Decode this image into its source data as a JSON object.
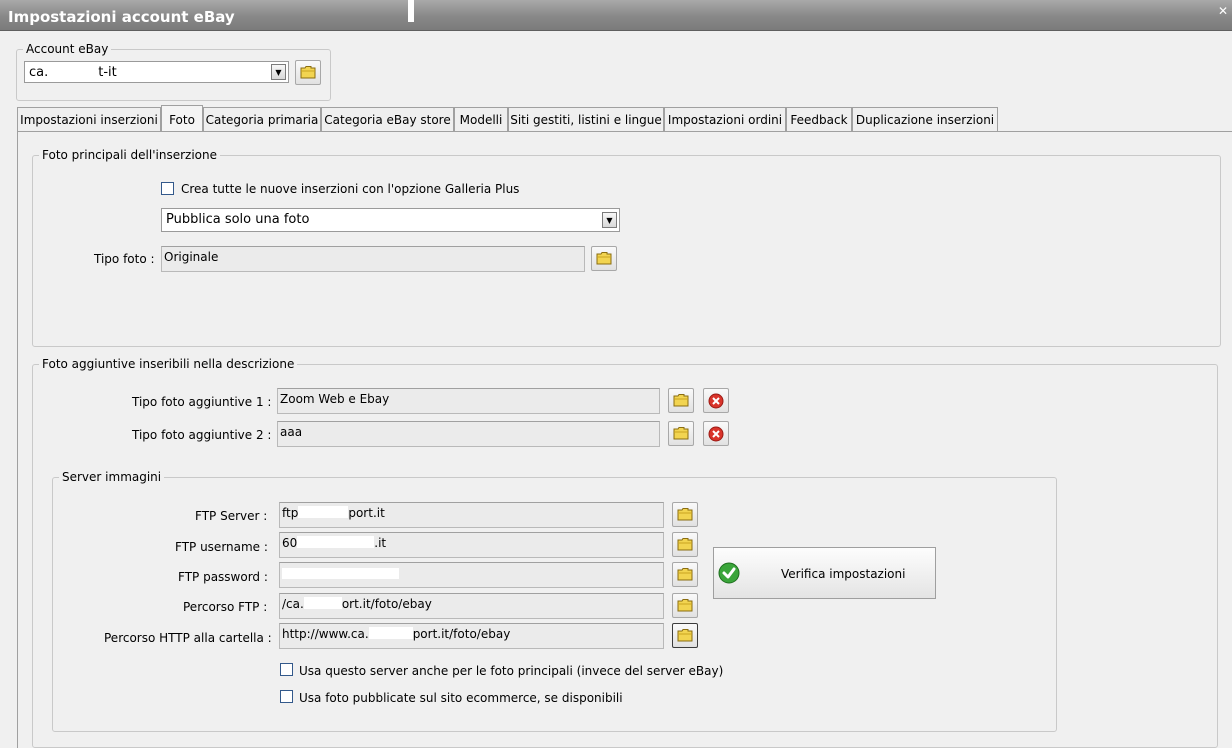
{
  "window": {
    "title": "Impostazioni account eBay"
  },
  "account": {
    "legend": "Account eBay",
    "selected_prefix": "ca.",
    "selected_suffix": "t-it"
  },
  "tabs": [
    {
      "label": "Impostazioni inserzioni",
      "selected": false
    },
    {
      "label": "Foto",
      "selected": true
    },
    {
      "label": "Categoria primaria",
      "selected": false
    },
    {
      "label": "Categoria eBay store",
      "selected": false
    },
    {
      "label": "Modelli",
      "selected": false
    },
    {
      "label": "Siti gestiti, listini e lingue",
      "selected": false
    },
    {
      "label": "Impostazioni ordini",
      "selected": false
    },
    {
      "label": "Feedback",
      "selected": false
    },
    {
      "label": "Duplicazione inserzioni",
      "selected": false
    }
  ],
  "main_photos": {
    "legend": "Foto principali dell'inserzione",
    "gallery_plus_label": "Crea tutte le nuove inserzioni con l'opzione Galleria Plus",
    "gallery_plus_checked": false,
    "publish_option": "Pubblica solo una foto",
    "photo_type_label": "Tipo foto :",
    "photo_type_value": "Originale"
  },
  "additional_photos": {
    "legend": "Foto aggiuntive inseribili nella descrizione",
    "type1_label": "Tipo foto aggiuntive 1 :",
    "type1_value": "Zoom Web e Ebay",
    "type2_label": "Tipo foto aggiuntive 2 :",
    "type2_value": "aaa"
  },
  "server": {
    "legend": "Server immagini",
    "ftp_server_label": "FTP Server :",
    "ftp_server_prefix": "ftp",
    "ftp_server_suffix": "port.it",
    "ftp_username_label": "FTP username :",
    "ftp_username_prefix": "60",
    "ftp_username_suffix": ".it",
    "ftp_password_label": "FTP password :",
    "ftp_path_label": "Percorso FTP :",
    "ftp_path_prefix": "/ca.",
    "ftp_path_suffix": "ort.it/foto/ebay",
    "http_path_label": "Percorso HTTP alla cartella :",
    "http_path_prefix": "http://www.ca.",
    "http_path_suffix": "port.it/foto/ebay",
    "verify_button": "Verifica impostazioni",
    "use_for_main_label": "Usa questo server anche per le foto principali (invece del server eBay)",
    "use_for_main_checked": false,
    "use_ecommerce_label": "Usa foto pubblicate sul sito ecommerce, se disponibili",
    "use_ecommerce_checked": false
  },
  "icons": {
    "folder": "folder-icon",
    "delete": "delete-icon",
    "check": "check-icon",
    "dropdown": "chevron-down-icon"
  },
  "colors": {
    "titlebar": "#8a8a8a",
    "folder": "#f2d450",
    "delete": "#d9342b",
    "check": "#3aa53a",
    "checkbox_border": "#33598b"
  }
}
